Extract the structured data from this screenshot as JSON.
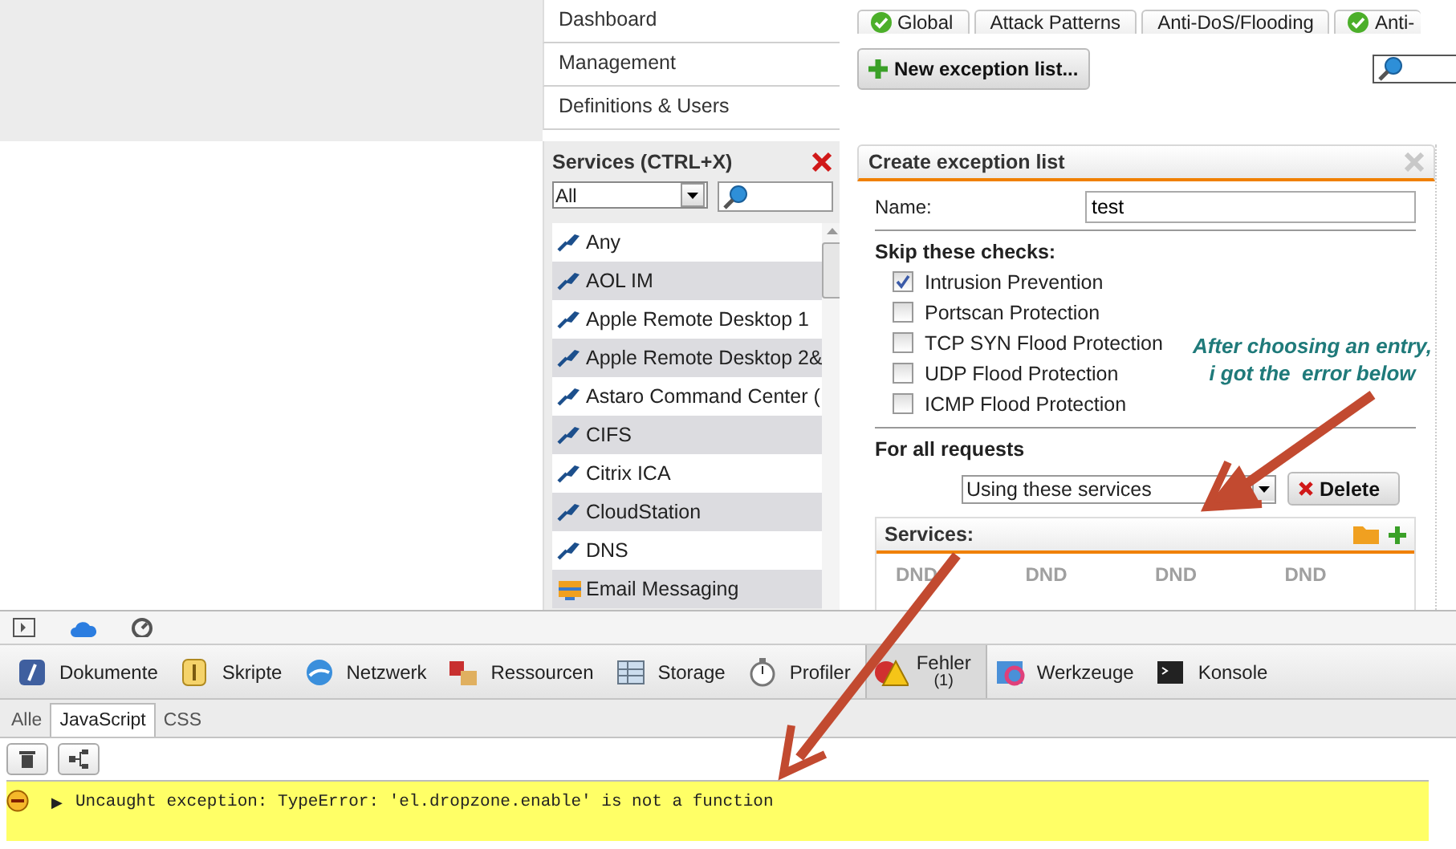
{
  "nav": {
    "items": [
      "Dashboard",
      "Management",
      "Definitions & Users"
    ]
  },
  "tabs": [
    {
      "label": "Global",
      "enabled": true
    },
    {
      "label": "Attack Patterns",
      "enabled": false
    },
    {
      "label": "Anti-DoS/Flooding",
      "enabled": false
    },
    {
      "label": "Anti-",
      "enabled": true
    }
  ],
  "new_button": "New exception list...",
  "services_panel": {
    "title": "Services (CTRL+X)",
    "filter": "All",
    "items": [
      {
        "label": "Any",
        "kind": "service"
      },
      {
        "label": "AOL IM",
        "kind": "service"
      },
      {
        "label": "Apple Remote Desktop 1",
        "kind": "service"
      },
      {
        "label": "Apple Remote Desktop 2&",
        "kind": "service"
      },
      {
        "label": "Astaro Command Center (",
        "kind": "service"
      },
      {
        "label": "CIFS",
        "kind": "service"
      },
      {
        "label": "Citrix ICA",
        "kind": "service"
      },
      {
        "label": "CloudStation",
        "kind": "service"
      },
      {
        "label": "DNS",
        "kind": "service"
      },
      {
        "label": "Email Messaging",
        "kind": "group"
      }
    ]
  },
  "dialog": {
    "title": "Create exception list",
    "name_label": "Name:",
    "name_value": "test",
    "skip_heading": "Skip these checks:",
    "checks": [
      {
        "label": "Intrusion Prevention",
        "checked": true
      },
      {
        "label": "Portscan Protection",
        "checked": false
      },
      {
        "label": "TCP SYN Flood Protection",
        "checked": false
      },
      {
        "label": "UDP Flood Protection",
        "checked": false
      },
      {
        "label": "ICMP Flood Protection",
        "checked": false
      }
    ],
    "requests_heading": "For all requests",
    "requests_select": "Using these services",
    "delete_button": "Delete",
    "services_box": {
      "title": "Services:",
      "columns": [
        "DND",
        "DND",
        "DND",
        "DND"
      ]
    }
  },
  "annotation": {
    "lines": [
      "After choosing an entry,",
      "i got the  error below"
    ]
  },
  "devtools": {
    "tabs": [
      {
        "label": "Dokumente",
        "kind": "documents",
        "selected": false
      },
      {
        "label": "Skripte",
        "kind": "scripts",
        "selected": false
      },
      {
        "label": "Netzwerk",
        "kind": "network",
        "selected": false
      },
      {
        "label": "Ressourcen",
        "kind": "resources",
        "selected": false
      },
      {
        "label": "Storage",
        "kind": "storage",
        "selected": false
      },
      {
        "label": "Profiler",
        "kind": "profiler",
        "selected": false
      },
      {
        "label": "Fehler",
        "count": "(1)",
        "kind": "errors",
        "selected": true
      },
      {
        "label": "Werkzeuge",
        "kind": "tools",
        "selected": false
      },
      {
        "label": "Konsole",
        "kind": "console",
        "selected": false
      }
    ],
    "subtabs": [
      {
        "label": "Alle",
        "selected": false
      },
      {
        "label": "JavaScript",
        "selected": true
      },
      {
        "label": "CSS",
        "selected": false
      }
    ],
    "error": {
      "expander": "▶",
      "message": "Uncaught exception: TypeError: 'el.dropzone.enable' is not a function"
    }
  }
}
